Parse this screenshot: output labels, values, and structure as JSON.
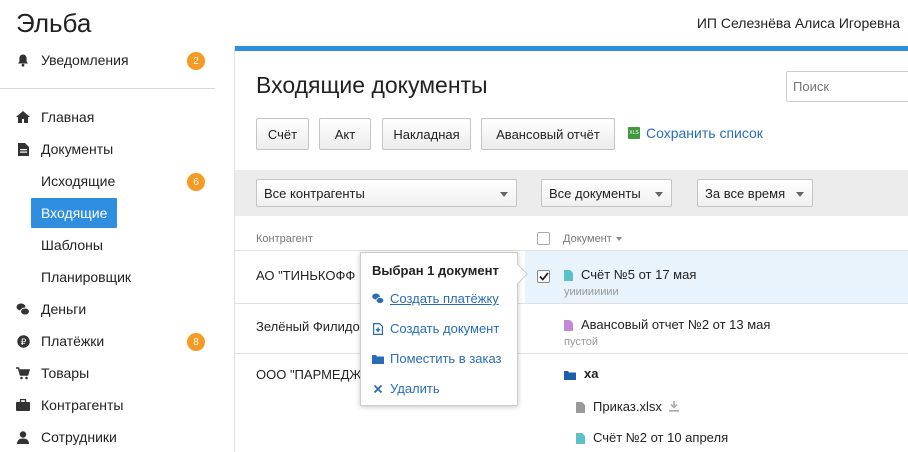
{
  "app": {
    "logo": "Эльба",
    "user": "ИП Селезнёва Алиса Игоревна"
  },
  "sidebar": {
    "notifications": {
      "label": "Уведомления",
      "badge": "2"
    },
    "items": [
      {
        "label": "Главная",
        "icon": "home-icon"
      },
      {
        "label": "Документы",
        "icon": "document-icon"
      },
      {
        "label": "Исходящие",
        "badge": "6"
      },
      {
        "label": "Входящие",
        "active": true
      },
      {
        "label": "Шаблоны"
      },
      {
        "label": "Планировщик"
      },
      {
        "label": "Деньги",
        "icon": "coins-icon"
      },
      {
        "label": "Платёжки",
        "icon": "ruble-icon",
        "badge": "8"
      },
      {
        "label": "Товары",
        "icon": "cart-icon"
      },
      {
        "label": "Контрагенты",
        "icon": "briefcase-icon"
      },
      {
        "label": "Сотрудники",
        "icon": "person-icon"
      }
    ]
  },
  "main": {
    "title": "Входящие документы",
    "search_placeholder": "Поиск",
    "buttons": [
      "Счёт",
      "Акт",
      "Накладная",
      "Авансовый отчёт"
    ],
    "save_list": "Сохранить список",
    "filters": {
      "contractor": "Все контрагенты",
      "docs": "Все документы",
      "period": "За все время"
    },
    "columns": {
      "contractor": "Контрагент",
      "document": "Документ"
    },
    "rows": [
      {
        "contractor": "АО \"ТИНЬКОФФ",
        "doc": "Счёт №5 от 17 мая",
        "sub": "уииииииии",
        "checked": true
      },
      {
        "contractor": "Зелёный Филидо",
        "doc": "Авансовый отчет №2 от 13 мая",
        "sub": "пустой"
      },
      {
        "contractor": "ООО \"ПАРМЕДЖ",
        "folder": "ха",
        "files": [
          "Приказ.xlsx",
          "Счёт №2 от 10 апреля"
        ]
      }
    ]
  },
  "popup": {
    "title": "Выбран 1 документ",
    "actions": [
      "Создать платёжку",
      "Создать документ",
      "Поместить в заказ",
      "Удалить"
    ]
  },
  "colors": {
    "accent": "#2f8ee0",
    "badge": "#f59a23",
    "link": "#2a6db5"
  }
}
